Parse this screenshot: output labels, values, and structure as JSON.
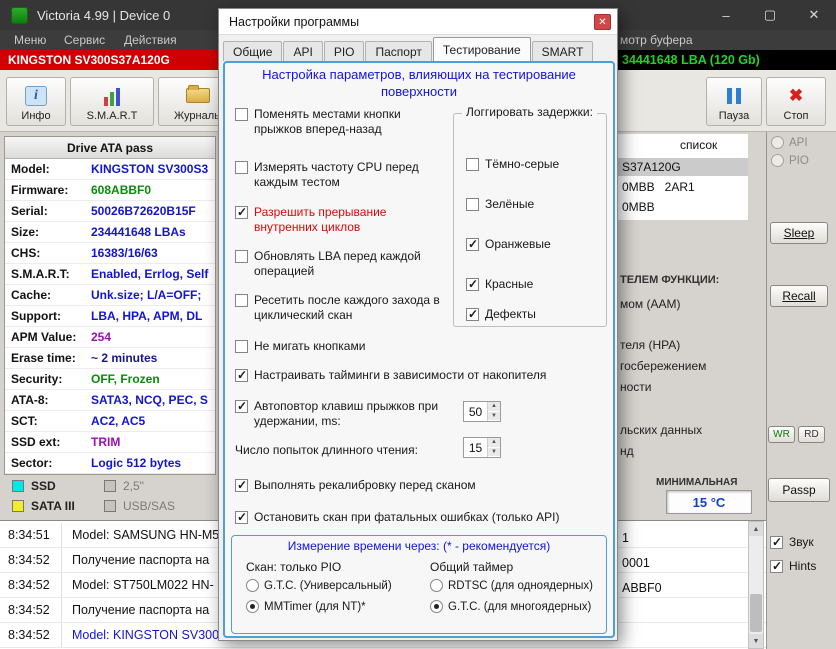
{
  "colors": {
    "accent_blue": "#4f9ed6",
    "heading_blue": "#1313dd",
    "alert_red": "#dd0808",
    "device_bar_red": "#cf0000",
    "lba_green": "#21d421",
    "value_blue": "#1314cf",
    "value_green": "#0a8a0a",
    "value_purple": "#9a10b0",
    "value_navy": "#151788"
  },
  "titlebar": {
    "title": "Victoria 4.99 | Device 0"
  },
  "menubar": {
    "items": [
      "Меню",
      "Сервис",
      "Действия"
    ],
    "right_fragment": "мотр буфера"
  },
  "device_bar": {
    "model": "KINGSTON SV300S37A120G",
    "lba": "34441648 LBA (120 Gb)"
  },
  "toolbar": {
    "info": "Инфо",
    "smart": "S.M.A.R.T",
    "journals": "Журналы",
    "pause": "Пауза",
    "stop": "Стоп"
  },
  "passport": {
    "header": "Drive ATA pass",
    "rows": [
      {
        "label": "Model:",
        "value": "KINGSTON SV300S3"
      },
      {
        "label": "Firmware:",
        "value": "608ABBF0"
      },
      {
        "label": "Serial:",
        "value": "50026B72620B15F"
      },
      {
        "label": "Size:",
        "value": "234441648 LBAs"
      },
      {
        "label": "CHS:",
        "value": "16383/16/63"
      },
      {
        "label": "S.M.A.R.T:",
        "value": "Enabled, Errlog, Self"
      },
      {
        "label": "Cache:",
        "value": "Unk.size; L/A=OFF;"
      },
      {
        "label": "Support:",
        "value": "LBA, HPA, APM, DL"
      },
      {
        "label": "APM Value:",
        "value": "254"
      },
      {
        "label": "Erase time:",
        "value": "~ 2 minutes"
      },
      {
        "label": "Security:",
        "value": "OFF, Frozen"
      },
      {
        "label": "ATA-8:",
        "value": "SATA3, NCQ, PEC, S"
      },
      {
        "label": "SCT:",
        "value": "AC2, AC5"
      },
      {
        "label": "SSD ext:",
        "value": "TRIM"
      },
      {
        "label": "Sector:",
        "value": "Logic 512 bytes"
      }
    ]
  },
  "legend": {
    "ssd": "SSD",
    "inch": "2,5\"",
    "sata": "SATA III",
    "usb": "USB/SAS"
  },
  "right_panel": {
    "list_header": "список",
    "selected_item": "S37A120G",
    "row2": "0MBB   2AR1",
    "row3": "0MBB",
    "labels": [
      "мом (AAM)",
      "теля (HPA)",
      "госбережением",
      "ности",
      "льских данных",
      "нд"
    ],
    "header_fragment": "ТЕЛЕМ ФУНКЦИИ:",
    "min_label": "МИНИМАЛЬНАЯ",
    "temperature": "15 °C"
  },
  "right_rail": {
    "api": "API",
    "pio": "PIO",
    "sleep": "Sleep",
    "recall": "Recall",
    "wr": "WR",
    "rd": "RD",
    "passp": "Passp",
    "sound": "Звук",
    "hints": "Hints",
    "sound_checked": true,
    "hints_checked": true
  },
  "log": {
    "rows": [
      {
        "time": "8:34:51",
        "msg": "Model: SAMSUNG HN-M5"
      },
      {
        "time": "8:34:52",
        "msg": "Получение паспорта на"
      },
      {
        "time": "8:34:52",
        "msg": "Model: ST750LM022 HN-"
      },
      {
        "time": "8:34:52",
        "msg": "Получение паспорта на"
      },
      {
        "time": "8:34:52",
        "msg": "Model: KINGSTON SV300"
      }
    ],
    "fragments": [
      "1",
      "0001",
      "ABBF0"
    ]
  },
  "dialog": {
    "title": "Настройки программы",
    "tabs": [
      "Общие",
      "API",
      "PIO",
      "Паспорт",
      "Тестирование",
      "SMART"
    ],
    "active_tab": "Тестирование",
    "heading": "Настройка параметров, влияющих на тестирование поверхности",
    "left_checks": [
      {
        "label": "Поменять местами кнопки прыжков вперед-назад",
        "checked": false
      },
      {
        "label": "Измерять частоту CPU перед каждым тестом",
        "checked": false
      },
      {
        "label": "Разрешить прерывание внутренних циклов",
        "checked": true
      },
      {
        "label": "Обновлять LBA перед каждой операцией",
        "checked": false
      },
      {
        "label": "Ресетить после каждого захода в циклический скан",
        "checked": false
      },
      {
        "label": "Не мигать кнопками",
        "checked": false
      }
    ],
    "delays_group": {
      "title": "Логгировать задержки:",
      "items": [
        {
          "label": "Тёмно-серые",
          "checked": false
        },
        {
          "label": "Зелёные",
          "checked": false
        },
        {
          "label": "Оранжевые",
          "checked": true
        },
        {
          "label": "Красные",
          "checked": true
        },
        {
          "label": "Дефекты",
          "checked": true
        }
      ]
    },
    "timing_check": {
      "label": "Настраивать тайминги в зависимости от накопителя",
      "checked": true
    },
    "autorepeat": {
      "label": "Автоповтор клавиш прыжков при удержании, ms:",
      "checked": true,
      "value": "50"
    },
    "long_read": {
      "label": "Число попыток длинного чтения:",
      "value": "15"
    },
    "recalibrate": {
      "label": "Выполнять рекалибровку перед сканом",
      "checked": true
    },
    "stop_fatal": {
      "label": "Остановить скан при фатальных ошибках (только API)",
      "checked": true
    },
    "timer_group": {
      "title": "Измерение времени через: (* - рекомендуется)",
      "left_title": "Скан: только PIO",
      "right_title": "Общий таймер",
      "left_options": [
        {
          "label": "G.T.C. (Универсальный)",
          "checked": false
        },
        {
          "label": "MMTimer (для NT)*",
          "checked": true
        }
      ],
      "right_options": [
        {
          "label": "RDTSC (для одноядерных)",
          "checked": false
        },
        {
          "label": "G.T.C. (для многоядерных)",
          "checked": true
        }
      ]
    }
  }
}
